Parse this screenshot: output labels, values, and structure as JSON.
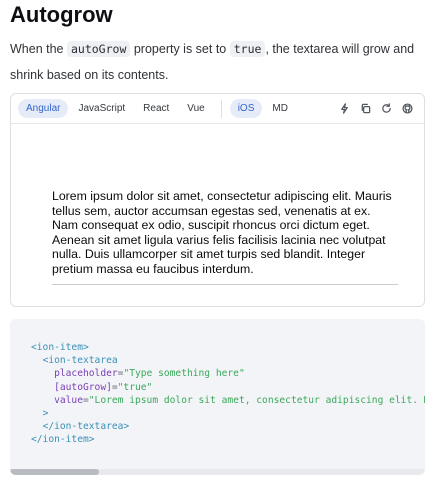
{
  "heading": "Autogrow",
  "intro": {
    "before": "When the ",
    "code1": "autoGrow",
    "middle": " property is set to ",
    "code2": "true",
    "after": ", the textarea will grow and shrink based on its contents."
  },
  "demo": {
    "framework_tabs": [
      {
        "label": "Angular",
        "active": true
      },
      {
        "label": "JavaScript",
        "active": false
      },
      {
        "label": "React",
        "active": false
      },
      {
        "label": "Vue",
        "active": false
      }
    ],
    "mode_tabs": [
      {
        "label": "iOS",
        "active": true
      },
      {
        "label": "MD",
        "active": false
      }
    ],
    "tools": [
      "lightning-icon",
      "copy-icon",
      "refresh-icon",
      "github-icon"
    ],
    "textarea_value": "Lorem ipsum dolor sit amet, consectetur adipiscing elit. Mauris tellus sem, auctor accumsan egestas sed, venenatis at ex. Nam consequat ex odio, suscipit rhoncus orci dictum eget. Aenean sit amet ligula varius felis facilisis lacinia nec volutpat nulla. Duis ullamcorper sit amet turpis sed blandit. Integer pretium massa eu faucibus interdum."
  },
  "code": {
    "l1": "<ion-item>",
    "l2": "<ion-textarea",
    "l3_attr": "placeholder",
    "l3_eq": "=",
    "l3_val": "\"Type something here\"",
    "l4_attr": "[autoGrow]",
    "l4_eq": "=",
    "l4_val": "\"true\"",
    "l5_attr": "value",
    "l5_eq": "=",
    "l5_val": "\"Lorem ipsum dolor sit amet, consectetur adipiscing elit. Mauris",
    "l6": ">",
    "l7": "</ion-textarea>",
    "l8": "</ion-item>"
  },
  "colors": {
    "accent": "#3366cc",
    "tab_active_bg": "#e6ebf8",
    "code_tag": "#3a8fb7",
    "code_attr": "#7a3fb5",
    "code_string": "#3aa85a"
  }
}
